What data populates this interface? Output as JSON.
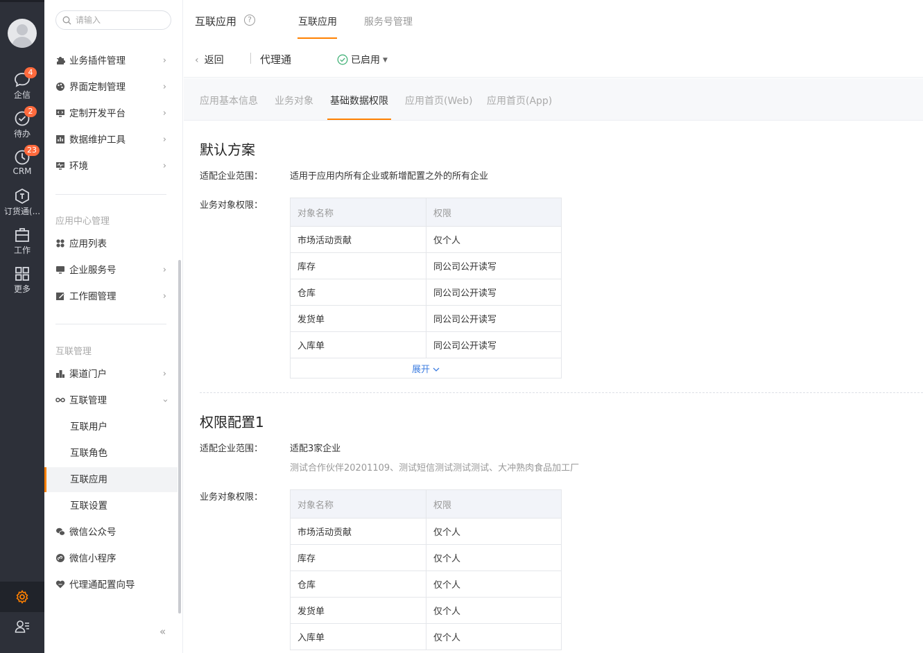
{
  "rail": {
    "items": [
      {
        "label": "企信",
        "badge": "4",
        "icon": "chat-bubble-icon"
      },
      {
        "label": "待办",
        "badge": "2",
        "icon": "check-circle-icon"
      },
      {
        "label": "CRM",
        "badge": "23",
        "icon": "clock-icon"
      },
      {
        "label": "订货通(...",
        "badge": "",
        "icon": "hexagon-icon"
      },
      {
        "label": "工作",
        "badge": "",
        "icon": "briefcase-icon"
      },
      {
        "label": "更多",
        "badge": "",
        "icon": "grid-icon"
      }
    ],
    "active_bottom_icon": "gear-icon",
    "bottom_icon": "user-list-icon",
    "accent": "#ff8000"
  },
  "sidebar": {
    "search_placeholder": "请输入",
    "items_top": [
      {
        "label": "业务插件管理",
        "icon": "puzzle-icon"
      },
      {
        "label": "界面定制管理",
        "icon": "palette-icon"
      },
      {
        "label": "定制开发平台",
        "icon": "monitor-code-icon"
      },
      {
        "label": "数据维护工具",
        "icon": "bar-chart-icon"
      },
      {
        "label": "环境",
        "icon": "monitor-pulse-icon"
      }
    ],
    "group_app_center": "应用中心管理",
    "items_app": [
      {
        "label": "应用列表",
        "icon": "apps-icon"
      },
      {
        "label": "企业服务号",
        "icon": "monitor-icon"
      },
      {
        "label": "工作圈管理",
        "icon": "edit-icon"
      }
    ],
    "group_interconnect": "互联管理",
    "items_interconnect": [
      {
        "label": "渠道门户",
        "icon": "buildings-icon"
      },
      {
        "label": "互联管理",
        "icon": "infinity-icon"
      }
    ],
    "sub_items": [
      "互联用户",
      "互联角色",
      "互联应用",
      "互联设置"
    ],
    "items_bottom": [
      {
        "label": "微信公众号",
        "icon": "wechat-icon"
      },
      {
        "label": "微信小程序",
        "icon": "mini-program-icon"
      },
      {
        "label": "代理通配置向导",
        "icon": "heart-guide-icon"
      }
    ],
    "collapse_label": "«"
  },
  "header": {
    "title": "互联应用",
    "help": "?",
    "tabs": [
      "互联应用",
      "服务号管理"
    ]
  },
  "subbar": {
    "back": "返回",
    "app_name": "代理通",
    "status": "已启用"
  },
  "tabs": [
    "应用基本信息",
    "业务对象",
    "基础数据权限",
    "应用首页(Web)",
    "应用首页(App)"
  ],
  "default_plan": {
    "title": "默认方案",
    "scope_label": "适配企业范围：",
    "scope_value": "适用于应用内所有企业或新增配置之外的所有企业",
    "perm_label": "业务对象权限：",
    "col_object": "对象名称",
    "col_perm": "权限",
    "rows": [
      {
        "object": "市场活动贡献",
        "perm": "仅个人"
      },
      {
        "object": "库存",
        "perm": "同公司公开读写"
      },
      {
        "object": "仓库",
        "perm": "同公司公开读写"
      },
      {
        "object": "发货单",
        "perm": "同公司公开读写"
      },
      {
        "object": "入库单",
        "perm": "同公司公开读写"
      }
    ],
    "expand": "展开"
  },
  "config1": {
    "title": "权限配置1",
    "scope_label": "适配企业范围：",
    "scope_value": "适配3家企业",
    "scope_detail": "测试合作伙伴20201109、测试短信测试测试测试、大冲熟肉食品加工厂",
    "perm_label": "业务对象权限：",
    "col_object": "对象名称",
    "col_perm": "权限",
    "rows": [
      {
        "object": "市场活动贡献",
        "perm": "仅个人"
      },
      {
        "object": "库存",
        "perm": "仅个人"
      },
      {
        "object": "仓库",
        "perm": "仅个人"
      },
      {
        "object": "发货单",
        "perm": "仅个人"
      },
      {
        "object": "入库单",
        "perm": "仅个人"
      }
    ]
  }
}
